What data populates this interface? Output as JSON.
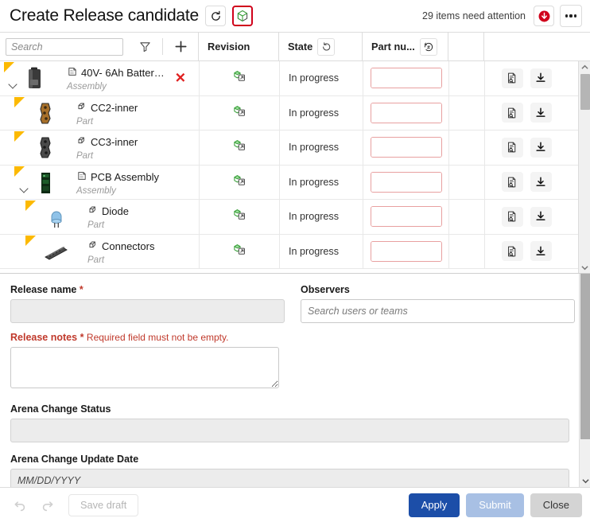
{
  "header": {
    "title": "Create Release candidate",
    "refresh_icon": "refresh-icon",
    "model_icon": "cube-3d-icon",
    "attention_text": "29 items need attention",
    "alert_icon": "alert-down-circle-icon",
    "more_icon": "more-options-icon"
  },
  "toolbar": {
    "search_placeholder": "Search",
    "search_value": "",
    "filter_icon": "filter-icon",
    "add_icon": "add-icon"
  },
  "table": {
    "columns": [
      {
        "label": "Revision",
        "icon": null
      },
      {
        "label": "State",
        "icon": "refresh-state-icon"
      },
      {
        "label": "Part nu...",
        "icon": "part-number-icon"
      }
    ],
    "rows": [
      {
        "name": "40V- 6Ah Battery...",
        "type": "Assembly",
        "depth": 0,
        "expandable": true,
        "thumbnail": "battery-thumbnail",
        "type_icon": "assembly-icon",
        "deletable": true,
        "revision_icon": "revision-cube-icon",
        "state": "In progress",
        "part_number": "",
        "part_number_button": "part-number-generate-icon",
        "actions": [
          "report-icon",
          "download-icon"
        ]
      },
      {
        "name": "CC2-inner",
        "type": "Part",
        "depth": 1,
        "expandable": false,
        "thumbnail": "cc2-inner-thumbnail",
        "type_icon": "part-icon",
        "deletable": false,
        "revision_icon": "revision-cube-icon",
        "state": "In progress",
        "part_number": "",
        "part_number_button": "part-number-generate-icon",
        "actions": [
          "report-icon",
          "download-icon"
        ]
      },
      {
        "name": "CC3-inner",
        "type": "Part",
        "depth": 1,
        "expandable": false,
        "thumbnail": "cc3-inner-thumbnail",
        "type_icon": "part-icon",
        "deletable": false,
        "revision_icon": "revision-cube-icon",
        "state": "In progress",
        "part_number": "",
        "part_number_button": "part-number-generate-icon",
        "actions": [
          "report-icon",
          "download-icon"
        ]
      },
      {
        "name": "PCB Assembly",
        "type": "Assembly",
        "depth": 1,
        "expandable": true,
        "thumbnail": "pcb-assembly-thumbnail",
        "type_icon": "assembly-icon",
        "deletable": false,
        "revision_icon": "revision-cube-icon",
        "state": "In progress",
        "part_number": "",
        "part_number_button": "part-number-generate-icon",
        "actions": [
          "report-icon",
          "download-icon"
        ]
      },
      {
        "name": "Diode",
        "type": "Part",
        "depth": 2,
        "expandable": false,
        "thumbnail": "diode-thumbnail",
        "type_icon": "part-icon",
        "deletable": false,
        "revision_icon": "revision-cube-icon",
        "state": "In progress",
        "part_number": "",
        "part_number_button": "part-number-generate-icon",
        "actions": [
          "report-icon",
          "download-icon"
        ]
      },
      {
        "name": "Connectors",
        "type": "Part",
        "depth": 2,
        "expandable": false,
        "thumbnail": "connectors-thumbnail",
        "type_icon": "part-icon",
        "deletable": false,
        "revision_icon": "revision-cube-icon",
        "state": "In progress",
        "part_number": "",
        "part_number_button": "part-number-generate-icon",
        "actions": [
          "report-icon",
          "download-icon"
        ]
      }
    ]
  },
  "form": {
    "release_name": {
      "label": "Release name",
      "required_mark": "*",
      "value": "",
      "placeholder": ""
    },
    "release_notes": {
      "label": "Release notes",
      "required_mark": "*",
      "error": "Required field must not be empty.",
      "value": ""
    },
    "observers": {
      "label": "Observers",
      "placeholder": "Search users or teams",
      "value": ""
    },
    "arena_change_status": {
      "label": "Arena Change Status",
      "value": "",
      "placeholder": ""
    },
    "arena_change_update_date": {
      "label": "Arena Change Update Date",
      "value": "",
      "placeholder": "MM/DD/YYYY"
    }
  },
  "footer": {
    "undo_icon": "undo-icon",
    "redo_icon": "redo-icon",
    "save_draft": "Save draft",
    "apply": "Apply",
    "submit": "Submit",
    "close": "Close"
  },
  "colors": {
    "accent_primary": "#1c4ea8",
    "accent_disabled": "#a8c0e4",
    "error": "#c0392b",
    "flag": "#fcb900",
    "alert": "#d0021b",
    "revision_green": "#4caf50"
  }
}
